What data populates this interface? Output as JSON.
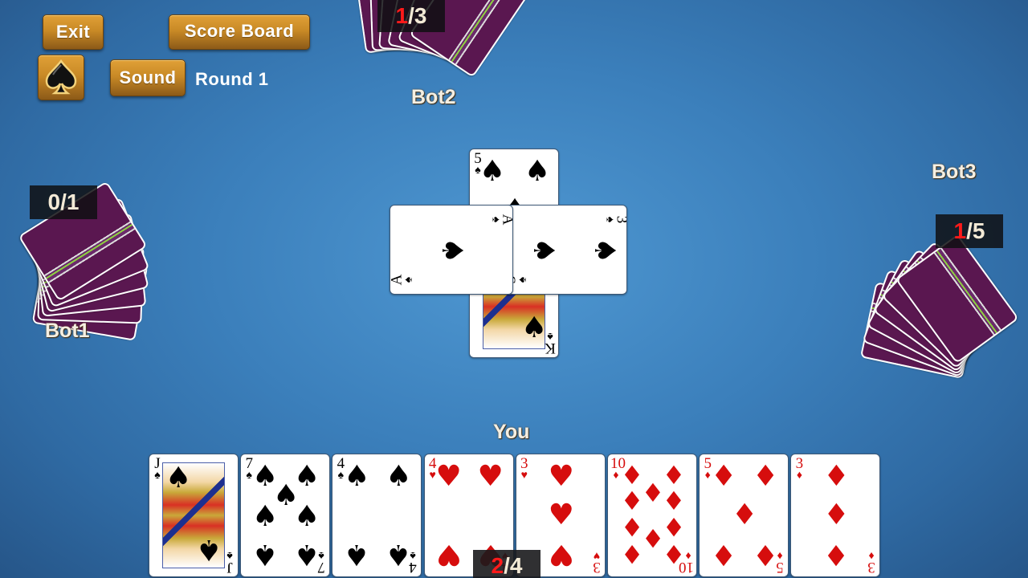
{
  "toolbar": {
    "exit_label": "Exit",
    "scoreboard_label": "Score Board",
    "sound_label": "Sound",
    "trump_icon": "spade-icon",
    "round_label": "Round 1"
  },
  "colors": {
    "button_gold": "#c98a26",
    "table_blue": "#3b7fbb",
    "red_suit": "#d60d0d",
    "card_back": "#5a1750",
    "tricks_won_highlight": "#ff1a1a"
  },
  "players": {
    "bot1": {
      "name": "Bot1",
      "tricks_won": "0",
      "tricks_bid": "1"
    },
    "bot2": {
      "name": "Bot2",
      "tricks_won": "1",
      "tricks_bid": "3"
    },
    "bot3": {
      "name": "Bot3",
      "tricks_won": "1",
      "tricks_bid": "5"
    },
    "you": {
      "name": "You",
      "tricks_won": "2",
      "tricks_bid": "4"
    }
  },
  "trick": {
    "bot2": {
      "rank": "5",
      "suit": "♠",
      "color": "black"
    },
    "bot1": {
      "rank": "A",
      "suit": "♠",
      "color": "black"
    },
    "bot3": {
      "rank": "3",
      "suit": "♠",
      "color": "black"
    },
    "you": {
      "rank": "K",
      "suit": "♠",
      "color": "black"
    }
  },
  "hand": [
    {
      "rank": "J",
      "suit": "♠",
      "color": "black",
      "face": true
    },
    {
      "rank": "7",
      "suit": "♠",
      "color": "black"
    },
    {
      "rank": "4",
      "suit": "♠",
      "color": "black"
    },
    {
      "rank": "4",
      "suit": "♥",
      "color": "red"
    },
    {
      "rank": "3",
      "suit": "♥",
      "color": "red"
    },
    {
      "rank": "10",
      "suit": "♦",
      "color": "red"
    },
    {
      "rank": "5",
      "suit": "♦",
      "color": "red"
    },
    {
      "rank": "3",
      "suit": "♦",
      "color": "red"
    }
  ]
}
